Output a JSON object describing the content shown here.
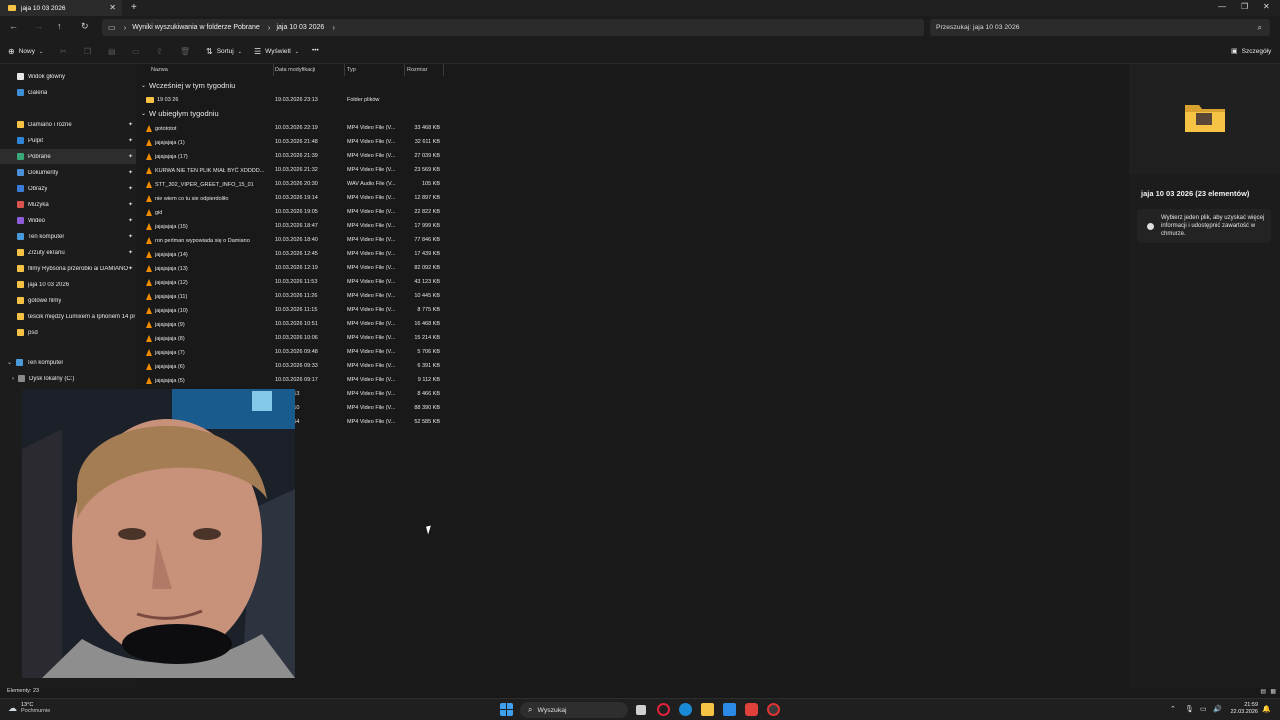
{
  "window": {
    "tab_title": "jaja 10 03 2026",
    "new_tab": "+",
    "close_tab": "✕"
  },
  "nav": {
    "breadcrumb": [
      "Wyniki wyszukiwania w folderze Pobrane",
      "jaja 10 03 2026"
    ],
    "search_placeholder": "Przeszukaj: jaja 10 03 2026"
  },
  "toolbar": {
    "new_label": "Nowy",
    "sort_label": "Sortuj",
    "view_label": "Wyświetl",
    "more_label": "•••",
    "details_label": "Szczegóły"
  },
  "sidebar": {
    "items": [
      {
        "label": "Widok główny",
        "color": "#e8e8e8",
        "pinned": false
      },
      {
        "label": "Galeria",
        "color": "#3f8fd8",
        "pinned": false
      },
      {
        "label": "Damiano i rozne",
        "color": "#f6c344",
        "pinned": true
      },
      {
        "label": "Pulpit",
        "color": "#2f86d6",
        "pinned": true
      },
      {
        "label": "Pobrane",
        "color": "#3aa876",
        "pinned": true
      },
      {
        "label": "Dokumenty",
        "color": "#4a90d9",
        "pinned": true
      },
      {
        "label": "Obrazy",
        "color": "#3a7bd5",
        "pinned": true
      },
      {
        "label": "Muzyka",
        "color": "#d9534f",
        "pinned": true
      },
      {
        "label": "Wideo",
        "color": "#8e5bd9",
        "pinned": true
      },
      {
        "label": "Ten komputer",
        "color": "#4a9ad9",
        "pinned": true
      },
      {
        "label": "Zrzuty ekranu",
        "color": "#f6c344",
        "pinned": true
      },
      {
        "label": "filmy Rybsona przerobki ai DAMIANO",
        "color": "#f6c344",
        "pinned": true
      },
      {
        "label": "jaja 10 03 2026",
        "color": "#f6c344",
        "pinned": false
      },
      {
        "label": "gotowe filmy",
        "color": "#f6c344",
        "pinned": false
      },
      {
        "label": "teścik między Lumixem a Iphonem 14 pr",
        "color": "#f6c344",
        "pinned": false
      },
      {
        "label": "psd",
        "color": "#f6c344",
        "pinned": false
      }
    ],
    "computer": "Ten komputer",
    "drive": "Dysk lokalny (C:)"
  },
  "columns": [
    "Nazwa",
    "Data modyfikacji",
    "Typ",
    "Rozmiar"
  ],
  "groups": {
    "earlier": "Wcześniej w tym tygodniu",
    "last_week": "W ubiegłym tygodniu"
  },
  "folder_row": {
    "name": "19 03 26",
    "date": "19.03.2026 23:13",
    "type": "Folder plików",
    "size": ""
  },
  "files": [
    {
      "name": "gotototot",
      "date": "10.03.2026 22:19",
      "type": "MP4 Video File (V...",
      "size": "33 468 KB"
    },
    {
      "name": "jajajajaja (1)",
      "date": "10.03.2026 21:48",
      "type": "MP4 Video File (V...",
      "size": "32 611 KB"
    },
    {
      "name": "jajajajaja (17)",
      "date": "10.03.2026 21:39",
      "type": "MP4 Video File (V...",
      "size": "27 039 KB"
    },
    {
      "name": "KURWA NIE TEN PLIK MIAŁ BYĆ XDDDD...",
      "date": "10.03.2026 21:32",
      "type": "MP4 Video File (V...",
      "size": "23 569 KB"
    },
    {
      "name": "STT_302_VIPER_GREET_INFO_15_01",
      "date": "10.03.2026 20:30",
      "type": "WAV Audio File (V...",
      "size": "105 KB"
    },
    {
      "name": "nie wiem co tu sie odpierdoliło",
      "date": "10.03.2026 19:14",
      "type": "MP4 Video File (V...",
      "size": "12 897 KB"
    },
    {
      "name": "gid",
      "date": "10.03.2026 19:05",
      "type": "MP4 Video File (V...",
      "size": "22 822 KB"
    },
    {
      "name": "jajajajaja (15)",
      "date": "10.03.2026 18:47",
      "type": "MP4 Video File (V...",
      "size": "17 999 KB"
    },
    {
      "name": "ron perlman wypowiada się o Damiano",
      "date": "10.03.2026 18:40",
      "type": "MP4 Video File (V...",
      "size": "77 846 KB"
    },
    {
      "name": "jajajajaja (14)",
      "date": "10.03.2026 12:45",
      "type": "MP4 Video File (V...",
      "size": "17 439 KB"
    },
    {
      "name": "jajajajaja (13)",
      "date": "10.03.2026 12:19",
      "type": "MP4 Video File (V...",
      "size": "82 092 KB"
    },
    {
      "name": "jajajajaja (12)",
      "date": "10.03.2026 11:53",
      "type": "MP4 Video File (V...",
      "size": "43 123 KB"
    },
    {
      "name": "jajajajaja (11)",
      "date": "10.03.2026 11:26",
      "type": "MP4 Video File (V...",
      "size": "10 445 KB"
    },
    {
      "name": "jajajajaja (10)",
      "date": "10.03.2026 11:15",
      "type": "MP4 Video File (V...",
      "size": "8 775 KB"
    },
    {
      "name": "jajajajaja (9)",
      "date": "10.03.2026 10:51",
      "type": "MP4 Video File (V...",
      "size": "16 468 KB"
    },
    {
      "name": "jajajajaja (8)",
      "date": "10.03.2026 10:06",
      "type": "MP4 Video File (V...",
      "size": "15 214 KB"
    },
    {
      "name": "jajajajaja (7)",
      "date": "10.03.2026 09:48",
      "type": "MP4 Video File (V...",
      "size": "5 706 KB"
    },
    {
      "name": "jajajajaja (6)",
      "date": "10.03.2026 09:33",
      "type": "MP4 Video File (V...",
      "size": "6 391 KB"
    },
    {
      "name": "jajajajaja (5)",
      "date": "10.03.2026 09:17",
      "type": "MP4 Video File (V...",
      "size": "9 112 KB"
    },
    {
      "name": "",
      "date": "026 09:13",
      "type": "MP4 Video File (V...",
      "size": "8 466 KB"
    },
    {
      "name": "",
      "date": "026 09:10",
      "type": "MP4 Video File (V...",
      "size": "88 390 KB"
    },
    {
      "name": "",
      "date": "026 08:54",
      "type": "MP4 Video File (V...",
      "size": "52 585 KB"
    }
  ],
  "details": {
    "title": "jaja 10 03 2026 (23 elementów)",
    "info": "Wybierz jeden plik, aby uzyskać więcej informacji i udostępnić zawartość w chmurze."
  },
  "status": {
    "count": "Elementy: 23"
  },
  "taskbar": {
    "weather_temp": "13°C",
    "weather_desc": "Pochmurnie",
    "search_label": "Wyszukaj",
    "time": "21:59",
    "date": "22.03.2026"
  }
}
